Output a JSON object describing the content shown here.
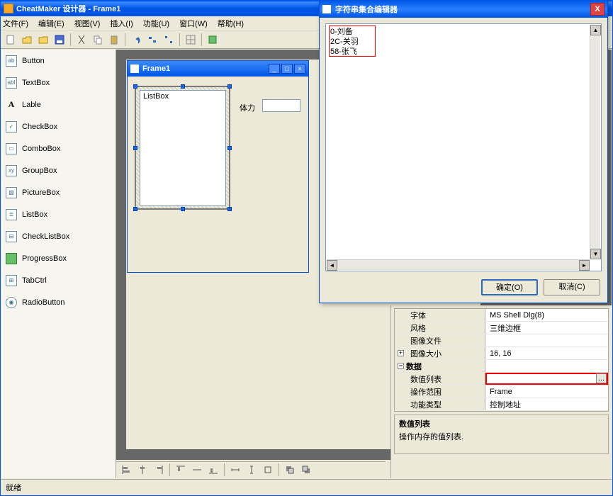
{
  "title": "CheatMaker 设计器 - Frame1",
  "menu": {
    "file": "文件(F)",
    "edit": "编辑(E)",
    "view": "视图(V)",
    "insert": "插入(I)",
    "func": "功能(U)",
    "window": "窗口(W)",
    "help": "帮助(H)"
  },
  "toolbox": {
    "items": [
      {
        "icon": "ab",
        "label": "Button"
      },
      {
        "icon": "abl",
        "label": "TextBox"
      },
      {
        "icon": "A",
        "label": "Lable"
      },
      {
        "icon": "✓",
        "label": "CheckBox"
      },
      {
        "icon": "▭",
        "label": "ComboBox"
      },
      {
        "icon": "xy",
        "label": "GroupBox"
      },
      {
        "icon": "▧",
        "label": "PictureBox"
      },
      {
        "icon": "≣",
        "label": "ListBox"
      },
      {
        "icon": "⊟",
        "label": "CheckListBox"
      },
      {
        "icon": "■",
        "label": "ProgressBox"
      },
      {
        "icon": "⊞",
        "label": "TabCtrl"
      },
      {
        "icon": "◉",
        "label": "RadioButton"
      }
    ]
  },
  "designer": {
    "frame_title": "Frame1",
    "listbox_label": "ListBox",
    "field_label": "体力"
  },
  "properties": {
    "rows": [
      {
        "key": "字体",
        "val": "MS Shell Dlg(8)"
      },
      {
        "key": "风格",
        "val": "三维边框"
      },
      {
        "key": "图像文件",
        "val": ""
      },
      {
        "key": "图像大小",
        "val": "16, 16",
        "expander": "+"
      },
      {
        "key": "数据",
        "val": "",
        "group": true,
        "expander": "−"
      },
      {
        "key": "数值列表",
        "val": "",
        "ellipsis": true,
        "highlight": true
      },
      {
        "key": "操作范围",
        "val": "Frame"
      },
      {
        "key": "功能类型",
        "val": "控制地址"
      }
    ],
    "desc_title": "数值列表",
    "desc_text": "操作内存的值列表."
  },
  "dialog": {
    "title": "字符串集合编辑器",
    "lines": [
      "0-刘备",
      "2C-关羽",
      "58-张飞"
    ],
    "ok": "确定(O)",
    "cancel": "取消(C)"
  },
  "status": "就绪"
}
